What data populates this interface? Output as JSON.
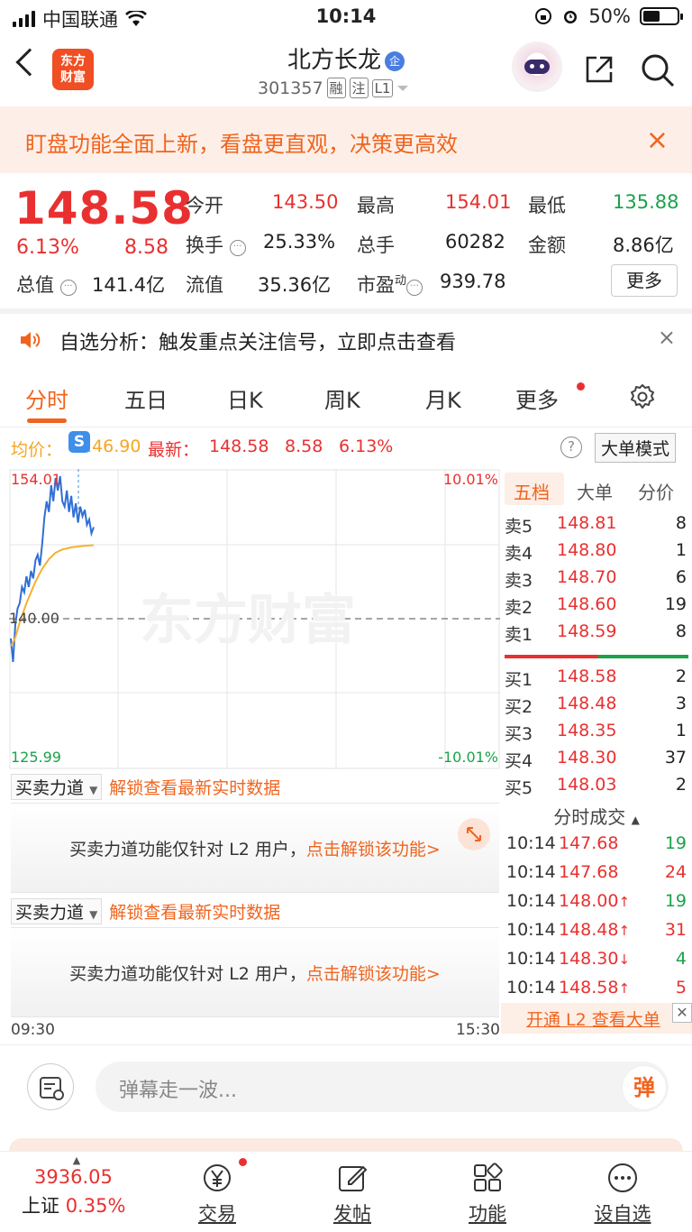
{
  "status_bar": {
    "carrier": "中国联通",
    "time": "10:14",
    "battery": "50%"
  },
  "header": {
    "logo_line1": "东方",
    "logo_line2": "财富",
    "stock_name": "北方长龙",
    "stock_badge": "企",
    "stock_code": "301357",
    "tags": [
      "融",
      "注",
      "L1"
    ]
  },
  "banner": {
    "text": "盯盘功能全面上新，看盘更直观，决策更高效",
    "close": "×"
  },
  "quote": {
    "price": "148.58",
    "change_pct": "6.13%",
    "change": "8.58",
    "open_label": "今开",
    "open": "143.50",
    "high_label": "最高",
    "high": "154.01",
    "low_label": "最低",
    "low": "135.88",
    "turnover_label": "换手",
    "turnover": "25.33%",
    "volume_label": "总手",
    "volume": "60282",
    "amount_label": "金额",
    "amount": "8.86亿",
    "mktcap_label": "总值",
    "mktcap": "141.4亿",
    "float_label": "流值",
    "float": "35.36亿",
    "pe_label": "市盈",
    "pe_sup": "动",
    "pe": "939.78",
    "more_label": "更多"
  },
  "alert": {
    "text": "自选分析：触发重点关注信号，立即点击查看",
    "close": "×"
  },
  "tabs": [
    "分时",
    "五日",
    "日K",
    "周K",
    "月K",
    "更多"
  ],
  "avg_bar": {
    "avg_label": "均价：",
    "avg_value": "146.90",
    "latest_label": "最新：",
    "latest_value": "148.58",
    "latest_change": "8.58",
    "latest_pct": "6.13%",
    "mode_button": "大单模式",
    "help": "?"
  },
  "chart_labels": {
    "top_left": "154.01",
    "top_right": "10.01%",
    "mid_left": "140.00",
    "bottom_left": "125.99",
    "bottom_right": "-10.01%",
    "watermark": "东方财富"
  },
  "chart_data": {
    "type": "line",
    "ylim": [
      125.99,
      154.01
    ],
    "reference": 140.0,
    "series": [
      {
        "name": "price",
        "color": "#2f6fd6",
        "values": [
          138.2,
          136.0,
          139.5,
          141.0,
          141.5,
          143.0,
          142.5,
          144.0,
          143.0,
          144.5,
          143.8,
          145.5,
          146.0,
          145.0,
          147.0,
          149.5,
          151.0,
          150.0,
          152.5,
          151.0,
          154.01,
          152.0,
          153.5,
          151.0,
          150.5,
          152.0,
          150.0,
          151.5,
          149.5,
          150.8,
          149.0,
          150.5,
          149.6,
          150.2,
          148.8,
          149.3,
          148.0,
          148.58
        ]
      },
      {
        "name": "avg",
        "color": "#f5b12f",
        "values": [
          137.5,
          137.8,
          138.3,
          139.0,
          139.7,
          140.3,
          140.9,
          141.5,
          142.0,
          142.5,
          143.0,
          143.5,
          143.9,
          144.3,
          144.7,
          145.0,
          145.3,
          145.6,
          145.8,
          146.0,
          146.2,
          146.3,
          146.4,
          146.5,
          146.55,
          146.6,
          146.65,
          146.7,
          146.72,
          146.75,
          146.78,
          146.8,
          146.82,
          146.84,
          146.86,
          146.88,
          146.89,
          146.9
        ]
      }
    ],
    "x_start": "09:30",
    "x_end": "15:30"
  },
  "book": {
    "tabs": [
      "五档",
      "大单",
      "分价"
    ],
    "asks": [
      {
        "label": "卖5",
        "price": "148.81",
        "vol": "8"
      },
      {
        "label": "卖4",
        "price": "148.80",
        "vol": "1"
      },
      {
        "label": "卖3",
        "price": "148.70",
        "vol": "6"
      },
      {
        "label": "卖2",
        "price": "148.60",
        "vol": "19"
      },
      {
        "label": "卖1",
        "price": "148.59",
        "vol": "8"
      }
    ],
    "bids": [
      {
        "label": "买1",
        "price": "148.58",
        "vol": "2"
      },
      {
        "label": "买2",
        "price": "148.48",
        "vol": "3"
      },
      {
        "label": "买3",
        "price": "148.35",
        "vol": "1"
      },
      {
        "label": "买4",
        "price": "148.30",
        "vol": "37"
      },
      {
        "label": "买5",
        "price": "148.03",
        "vol": "2"
      }
    ]
  },
  "force": {
    "dropdown": "买卖力道",
    "unlock_link": "解锁查看最新实时数据",
    "box_text": "买卖力道功能仅针对 L2 用户，",
    "box_link": "点击解锁该功能>"
  },
  "trades": {
    "title": "分时成交",
    "rows": [
      {
        "time": "10:14",
        "price": "147.68",
        "arrow": "",
        "vol": "19",
        "vcolor": "#1aa34a"
      },
      {
        "time": "10:14",
        "price": "147.68",
        "arrow": "",
        "vol": "24",
        "vcolor": "#e93030"
      },
      {
        "time": "10:14",
        "price": "148.00",
        "arrow": "↑",
        "vol": "19",
        "vcolor": "#1aa34a"
      },
      {
        "time": "10:14",
        "price": "148.48",
        "arrow": "↑",
        "vol": "31",
        "vcolor": "#e93030"
      },
      {
        "time": "10:14",
        "price": "148.30",
        "arrow": "↓",
        "vol": "4",
        "vcolor": "#1aa34a"
      },
      {
        "time": "10:14",
        "price": "148.58",
        "arrow": "↑",
        "vol": "5",
        "vcolor": "#e93030"
      }
    ],
    "promo": "开通 L2 查看大单"
  },
  "comment": {
    "placeholder": "弹幕走一波...",
    "danmu": "弹"
  },
  "bottom_nav": {
    "index_value": "3936.05",
    "index_name": "上证",
    "index_pct": "0.35%",
    "items": [
      "交易",
      "发帖",
      "功能",
      "设自选"
    ]
  }
}
